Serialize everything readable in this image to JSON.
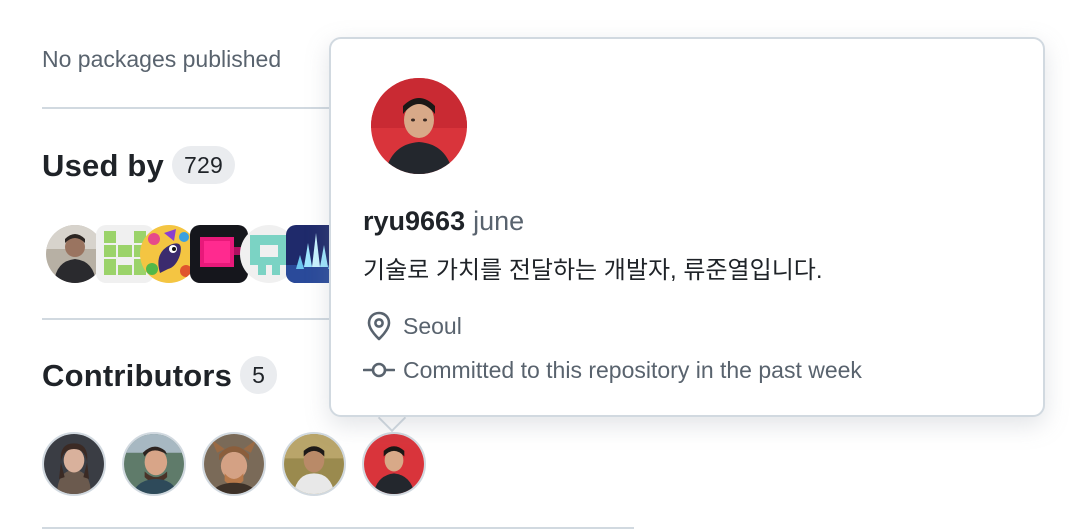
{
  "packages": {
    "empty_text": "No packages published"
  },
  "used_by": {
    "title": "Used by",
    "count": "729",
    "avatars": [
      {
        "name": "dependent-avatar-1"
      },
      {
        "name": "dependent-avatar-2"
      },
      {
        "name": "dependent-avatar-3"
      },
      {
        "name": "dependent-avatar-4"
      },
      {
        "name": "dependent-avatar-5"
      },
      {
        "name": "dependent-avatar-6"
      }
    ]
  },
  "contributors": {
    "title": "Contributors",
    "count": "5"
  },
  "hovercard": {
    "login": "ryu9663",
    "full_name": "june",
    "bio": "기술로 가치를 전달하는 개발자, 류준열입니다.",
    "location": "Seoul",
    "commit_note": "Committed to this repository in the past week",
    "location_icon": "location-pin-icon",
    "commit_icon": "git-commit-icon"
  },
  "colors": {
    "text_primary": "#1f2328",
    "text_muted": "#59636e",
    "border": "#d1d9e0",
    "counter_bg": "#eaecef",
    "avatar_red": "#d9343b"
  }
}
